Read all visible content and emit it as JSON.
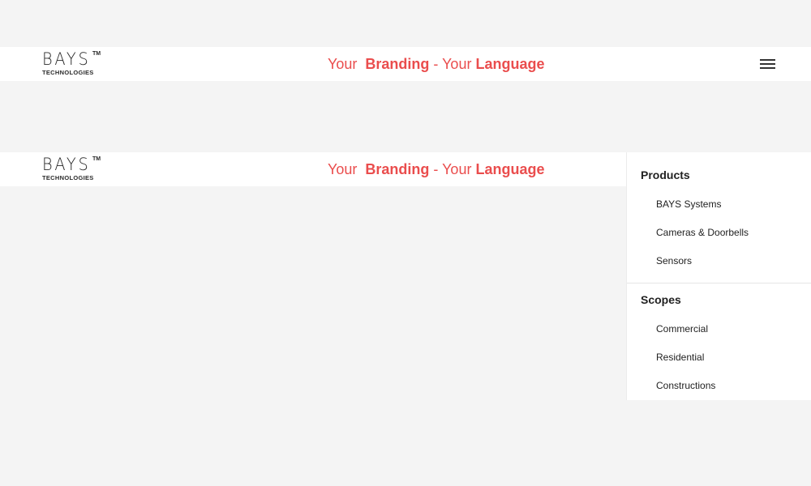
{
  "logo": {
    "word": "BAYS",
    "tm": "TM",
    "sub": "TECHNOLOGIES"
  },
  "tagline": {
    "part1": "Your",
    "part2": "Branding",
    "part3": "- Your",
    "part4": "Language"
  },
  "menu_button": {
    "icon": "hamburger-menu-icon"
  },
  "side_menu": {
    "products": {
      "title": "Products",
      "items": [
        "BAYS Systems",
        "Cameras & Doorbells",
        "Sensors"
      ]
    },
    "scopes": {
      "title": "Scopes",
      "items": [
        "Commercial",
        "Residential",
        "Constructions"
      ]
    }
  },
  "colors": {
    "accent": "#ea4d4d",
    "background": "#f4f4f4",
    "surface": "#ffffff",
    "text": "#222222"
  }
}
